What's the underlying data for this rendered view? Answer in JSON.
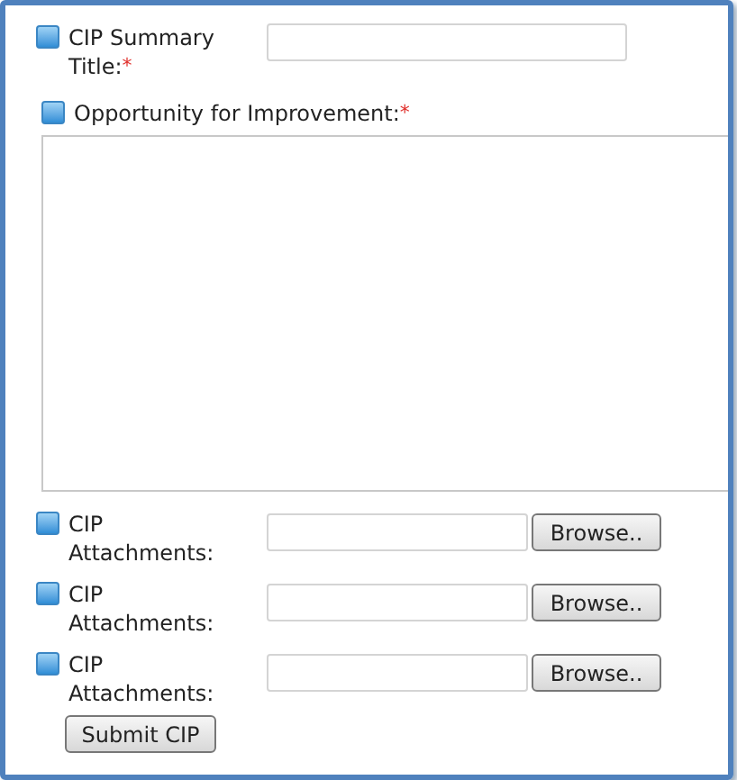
{
  "title_field": {
    "label": "CIP Summary Title:",
    "required": true,
    "marker": "*"
  },
  "opportunity": {
    "label": "Opportunity for Improvement:",
    "required": true,
    "marker": "*"
  },
  "attachments": [
    {
      "label": "CIP Attachments:",
      "button": "Browse.."
    },
    {
      "label": "CIP Attachments:",
      "button": "Browse.."
    },
    {
      "label": "CIP Attachments:",
      "button": "Browse.."
    }
  ],
  "submit": "Submit CIP"
}
